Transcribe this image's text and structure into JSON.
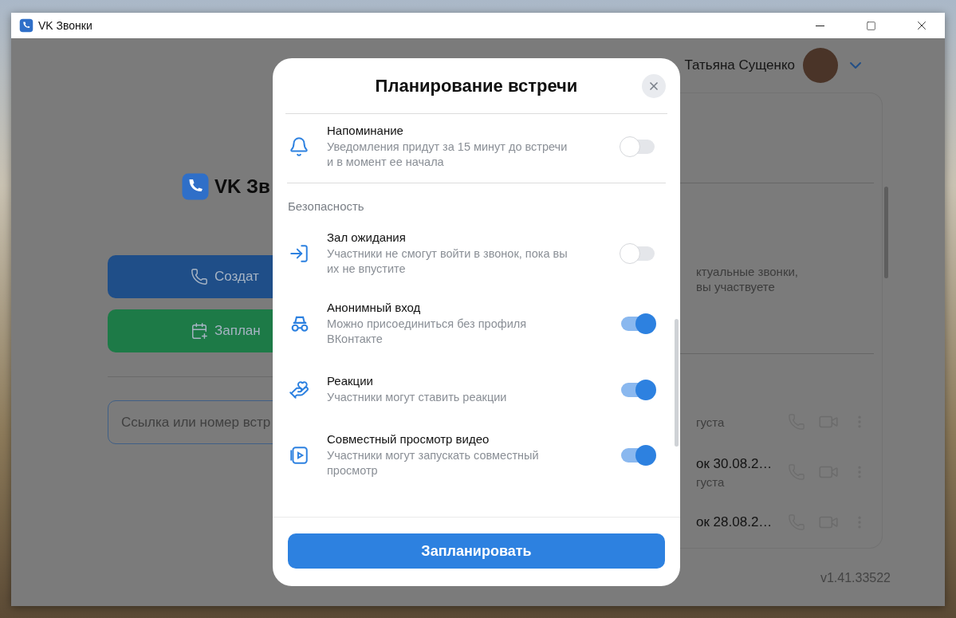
{
  "window": {
    "title": "VK Звонки"
  },
  "header": {
    "user_name": "Татьяна Сущенко"
  },
  "home": {
    "logo_text": "VK Зв",
    "create_button": "Создат",
    "schedule_button": "Заплан",
    "link_field": {
      "placeholder": "Ссылка или номер встр"
    }
  },
  "calls_panel": {
    "hint_lines": [
      "ктуальные звонки,",
      "вы участвуете"
    ],
    "calls": [
      {
        "subtitle": "густа"
      },
      {
        "title": "ок 30.08.2…",
        "subtitle": "густа"
      },
      {
        "title": "ок 28.08.2…"
      }
    ]
  },
  "version": "v1.41.33522",
  "modal": {
    "title": "Планирование встречи",
    "sections": [
      {
        "rows": [
          {
            "title": "Напоминание",
            "description": "Уведомления придут за 15 минут до встречи и в момент ее начала",
            "on": false
          }
        ]
      },
      {
        "header": "Безопасность",
        "rows": [
          {
            "title": "Зал ожидания",
            "description": "Участники не смогут войти в звонок, пока вы их не впустите",
            "on": false
          },
          {
            "title": "Анонимный вход",
            "description": "Можно присоединиться без профиля ВКонтакте",
            "on": true
          },
          {
            "title": "Реакции",
            "description": "Участники могут ставить реакции",
            "on": true
          },
          {
            "title": "Совместный просмотр видео",
            "description": "Участники могут запускать совместный просмотр",
            "on": true
          }
        ]
      }
    ],
    "submit_button": "Запланировать"
  }
}
